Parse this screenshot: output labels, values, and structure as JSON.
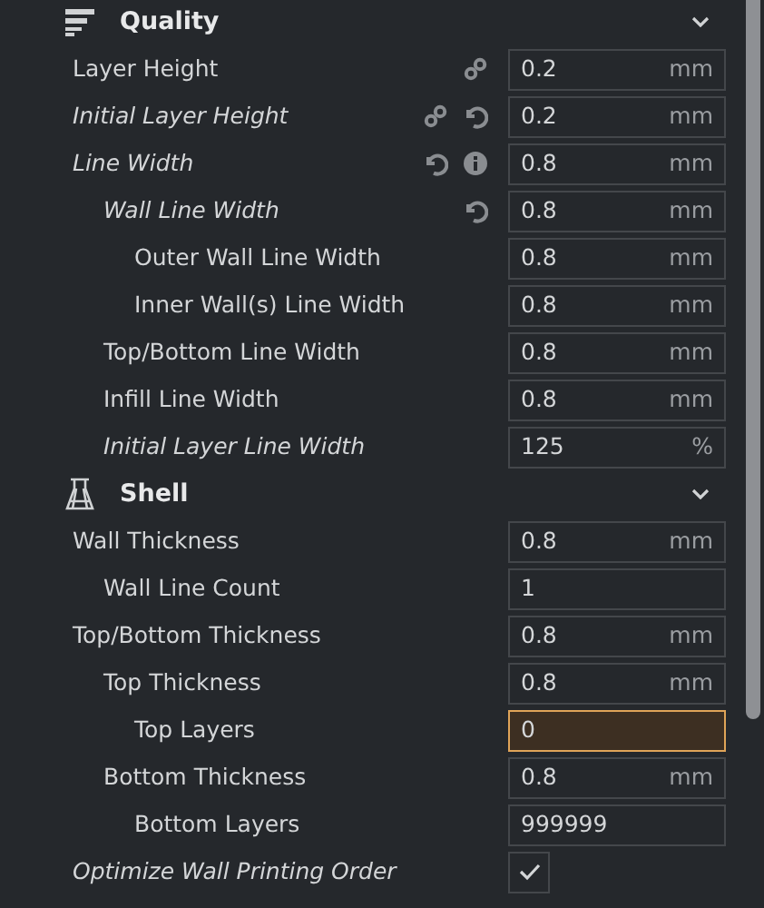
{
  "sections": [
    {
      "title": "Quality",
      "expanded": true,
      "settings": [
        {
          "label": "Layer Height",
          "kind": "number",
          "value": "0.2",
          "unit": "mm",
          "overridden": false,
          "highlighted": false,
          "linked": true,
          "resettable": false,
          "info": false
        },
        {
          "label": "Initial Layer Height",
          "kind": "number",
          "value": "0.2",
          "unit": "mm",
          "overridden": true,
          "highlighted": false,
          "linked": true,
          "resettable": true,
          "info": false
        },
        {
          "label": "Line Width",
          "kind": "number",
          "value": "0.8",
          "unit": "mm",
          "overridden": true,
          "highlighted": false,
          "linked": false,
          "resettable": true,
          "info": true,
          "children": [
            {
              "label": "Wall Line Width",
              "kind": "number",
              "value": "0.8",
              "unit": "mm",
              "overridden": true,
              "highlighted": false,
              "linked": false,
              "resettable": true,
              "info": false,
              "children": [
                {
                  "label": "Outer Wall Line Width",
                  "kind": "number",
                  "value": "0.8",
                  "unit": "mm",
                  "overridden": false,
                  "highlighted": false,
                  "linked": false,
                  "resettable": false,
                  "info": false
                },
                {
                  "label": "Inner Wall(s) Line Width",
                  "kind": "number",
                  "value": "0.8",
                  "unit": "mm",
                  "overridden": false,
                  "highlighted": false,
                  "linked": false,
                  "resettable": false,
                  "info": false
                }
              ]
            },
            {
              "label": "Top/Bottom Line Width",
              "kind": "number",
              "value": "0.8",
              "unit": "mm",
              "overridden": false,
              "highlighted": false,
              "linked": false,
              "resettable": false,
              "info": false
            },
            {
              "label": "Infill Line Width",
              "kind": "number",
              "value": "0.8",
              "unit": "mm",
              "overridden": false,
              "highlighted": false,
              "linked": false,
              "resettable": false,
              "info": false
            },
            {
              "label": "Initial Layer Line Width",
              "kind": "number",
              "value": "125",
              "unit": "%",
              "overridden": true,
              "highlighted": false,
              "linked": false,
              "resettable": false,
              "info": false
            }
          ]
        }
      ]
    },
    {
      "title": "Shell",
      "expanded": true,
      "settings": [
        {
          "label": "Wall Thickness",
          "kind": "number",
          "value": "0.8",
          "unit": "mm",
          "overridden": false,
          "highlighted": false,
          "linked": false,
          "resettable": false,
          "info": false,
          "children": [
            {
              "label": "Wall Line Count",
              "kind": "number",
              "value": "1",
              "overridden": false,
              "highlighted": false,
              "linked": false,
              "resettable": false,
              "info": false
            }
          ]
        },
        {
          "label": "Top/Bottom Thickness",
          "kind": "number",
          "value": "0.8",
          "unit": "mm",
          "overridden": false,
          "highlighted": false,
          "linked": false,
          "resettable": false,
          "info": false,
          "children": [
            {
              "label": "Top Thickness",
              "kind": "number",
              "value": "0.8",
              "unit": "mm",
              "overridden": false,
              "highlighted": false,
              "linked": false,
              "resettable": false,
              "info": false,
              "children": [
                {
                  "label": "Top Layers",
                  "kind": "number",
                  "value": "0",
                  "overridden": false,
                  "highlighted": true,
                  "linked": false,
                  "resettable": false,
                  "info": false
                }
              ]
            },
            {
              "label": "Bottom Thickness",
              "kind": "number",
              "value": "0.8",
              "unit": "mm",
              "overridden": false,
              "highlighted": false,
              "linked": false,
              "resettable": false,
              "info": false,
              "children": [
                {
                  "label": "Bottom Layers",
                  "kind": "number",
                  "value": "999999",
                  "overridden": false,
                  "highlighted": false,
                  "linked": false,
                  "resettable": false,
                  "info": false
                }
              ]
            }
          ]
        },
        {
          "label": "Optimize Wall Printing Order",
          "kind": "checkbox",
          "checked": true,
          "overridden": true,
          "linked": false,
          "resettable": false,
          "info": false
        }
      ]
    }
  ]
}
